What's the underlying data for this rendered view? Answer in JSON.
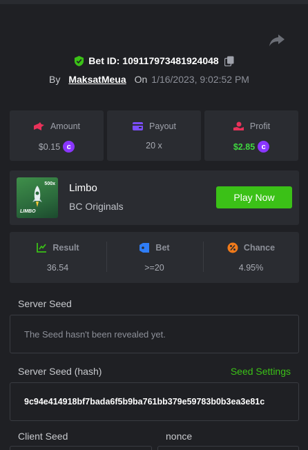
{
  "header": {
    "bet_id": "Bet ID: 10911797348192404​8",
    "by_label": "By",
    "username": "MaksatMeua",
    "on_label": "On",
    "date": "1/16/2023, 9:02:52 PM"
  },
  "stats": [
    {
      "label": "Amount",
      "value": "$0.15",
      "icon": "amount-icon"
    },
    {
      "label": "Payout",
      "value": "20 x",
      "icon": "payout-icon"
    },
    {
      "label": "Profit",
      "value": "$2.85",
      "icon": "profit-icon"
    }
  ],
  "coin_symbol": "c",
  "game": {
    "title": "Limbo",
    "subtitle": "BC Originals",
    "thumb_label": "LIMBO",
    "thumb_badge": "500x",
    "play_label": "Play Now"
  },
  "bet_info": [
    {
      "label": "Result",
      "value": "36.54"
    },
    {
      "label": "Bet",
      "value": ">=20"
    },
    {
      "label": "Chance",
      "value": "4.95%"
    }
  ],
  "server_seed": {
    "label": "Server Seed",
    "value": "The Seed hasn't been revealed yet."
  },
  "server_seed_hash": {
    "label": "Server Seed (hash)",
    "settings_link": "Seed Settings",
    "value": "9c94e414918bf7bada6f5b9ba761bb379e59783b0b3ea3e81c"
  },
  "client_seed": {
    "label": "Client Seed"
  },
  "nonce": {
    "label": "nonce"
  },
  "colors": {
    "accent_green": "#3bc117",
    "profit_green": "#3fd63f",
    "coin_purple": "#8a36ff",
    "background": "#1f2024",
    "card": "#2a2c31"
  }
}
